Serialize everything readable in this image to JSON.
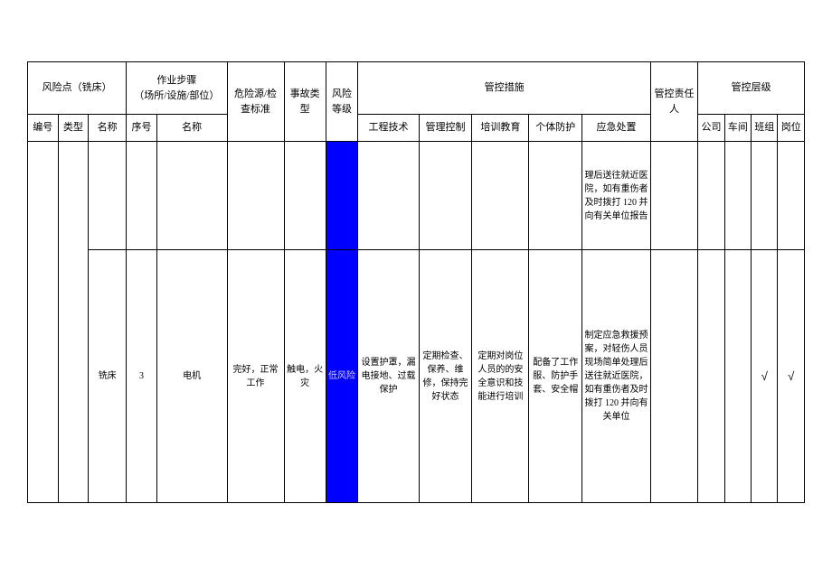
{
  "head": {
    "risk_point": "风险点（铣床）",
    "work_steps": "作业步骤\n（场所/设施/部位）",
    "hazard_std": "危险源/检查标准",
    "accident_type": "事故类型",
    "risk_level_h": "风险等级",
    "controls": "管控措施",
    "responsible": "管控责任人",
    "control_level": "管控层级",
    "sub": {
      "no": "编号",
      "type": "类型",
      "name": "名称",
      "seq": "序号",
      "step_name": "名称",
      "eng": "工程技术",
      "mgmt": "管理控制",
      "train": "培训教育",
      "ppe": "个体防护",
      "emerg": "应急处置",
      "company": "公司",
      "workshop": "车间",
      "team": "班组",
      "post": "岗位"
    }
  },
  "row1": {
    "emerg": "理后送往就近医院，如有重伤者及时拨打 120 并向有关单位报告"
  },
  "row2": {
    "name": "铣床",
    "seq": "3",
    "step_name": "电机",
    "hazard": "完好，正常工作",
    "accident": "触电，火灾",
    "risk_level": "低风险",
    "eng": "设置护罩，漏电接地、过载保护",
    "mgmt": "定期检查、保养、维修，保持完好状态",
    "train": "定期对岗位人员的的安全意识和技能进行培训",
    "ppe": "配备了工作服、防护手套、安全帽",
    "emerg": "制定应急救援预案，对轻伤人员现场简单处理后送往就近医院，如有重伤者及时拨打 120 并向有关单位",
    "team": "√",
    "post": "√"
  }
}
